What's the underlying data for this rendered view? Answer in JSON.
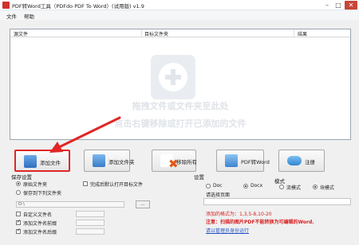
{
  "window": {
    "title": "PDF转Word工具（PDFdo PDF To Word）(试用版) v1.9",
    "minimize": "–",
    "maximize": "□",
    "close": "✕"
  },
  "menu": {
    "file": "文件",
    "help": "帮助"
  },
  "file_list": {
    "columns": [
      "源文件",
      "目标文件夹",
      "结果"
    ],
    "rows": [],
    "drop_hint_1": "拖拽文件或文件夹至此处",
    "drop_hint_2": "点击右键移除或打开已添加的文件"
  },
  "toolbar": {
    "add_file": "添加文件",
    "add_folder": "添加文件夹",
    "remove_all": "移除所有",
    "convert": "PDF转Word",
    "register": "注册"
  },
  "save_settings": {
    "title": "保存设置",
    "option_original": "原始文件夹",
    "option_custom": "保存到下列文件夹",
    "selected": "原始文件夹",
    "open_after": "完成后默认打开目标文件",
    "open_after_checked": false,
    "path": "D:\\",
    "browse": "...",
    "custom_name": "自定义文件名",
    "custom_name_checked": false,
    "prefix": "添加文件名前缀",
    "prefix_checked": true,
    "suffix": "添加文件名后缀",
    "suffix_checked": true
  },
  "settings": {
    "title": "设置",
    "format_doc": "Doc",
    "format_docx": "Docx",
    "selected_format": "Docx",
    "pages_label": "请选择页面",
    "pages_value": ""
  },
  "mode": {
    "title": "模式",
    "flow": "流模式",
    "block": "块模式",
    "selected": "块模式"
  },
  "notes": {
    "format_example": "添加的格式为：1,3,5-8,10-20",
    "warning": "注意：扫描的图片PDF不能转换为可编辑的Word.",
    "link": "请以管理员身份运行"
  },
  "colors": {
    "highlight": "#e02626",
    "note": "#d71f1f",
    "link": "#2553c7"
  }
}
